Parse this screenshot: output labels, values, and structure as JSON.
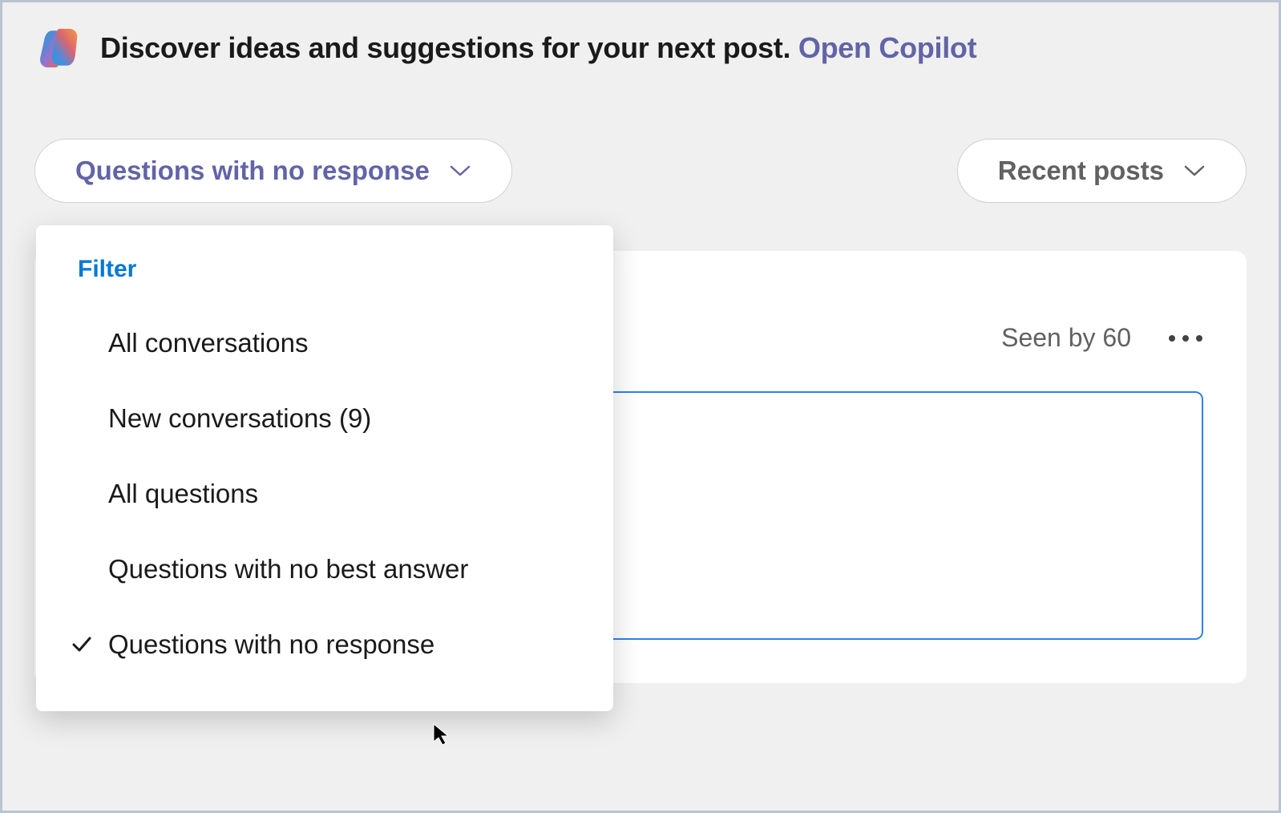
{
  "banner": {
    "text": "Discover ideas and suggestions for your next post.",
    "link_label": "Open Copilot"
  },
  "filters": {
    "primary_label": "Questions with no response",
    "secondary_label": "Recent posts"
  },
  "dropdown": {
    "header": "Filter",
    "items": [
      {
        "label": "All conversations",
        "selected": false
      },
      {
        "label": "New conversations (9)",
        "selected": false
      },
      {
        "label": "All questions",
        "selected": false
      },
      {
        "label": "Questions with no best answer",
        "selected": false
      },
      {
        "label": "Questions with no response",
        "selected": true
      }
    ]
  },
  "post": {
    "seen_by": "Seen by 60"
  }
}
